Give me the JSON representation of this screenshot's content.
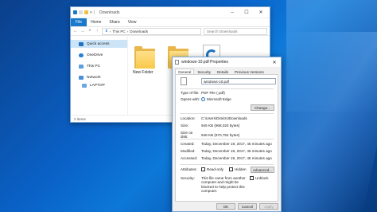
{
  "colors": {
    "desktop": "#0a63c9",
    "accent": "#1979ca",
    "folder": "#f7c948",
    "selection": "#cce4f7"
  },
  "explorer": {
    "title": "Downloads",
    "ribbon_tabs": [
      "File",
      "Home",
      "Share",
      "View"
    ],
    "path": [
      "This PC",
      "Downloads"
    ],
    "search_placeholder": "Search Downloads",
    "nav": {
      "quick_access": "Quick access",
      "onedrive": "OneDrive",
      "this_pc": "This PC",
      "network": "Network",
      "laptop": "LAPTOP"
    },
    "items": {
      "folder1": "New Folder",
      "folder2": "",
      "pdf": "pdf"
    },
    "status": "2 items"
  },
  "props": {
    "title": "windows-10.pdf Properties",
    "tabs": [
      "General",
      "Security",
      "Details",
      "Previous Versions"
    ],
    "filename": "windows-10.pdf",
    "type_label": "Type of file:",
    "type_value": "PDF File (.pdf)",
    "opens_label": "Opens with:",
    "opens_value": "Microsoft Edge",
    "change_label": "Change...",
    "location_label": "Location:",
    "location_value": "C:\\Users\\Dimitro\\Downloads",
    "size_label": "Size:",
    "size_value": "945 KB (968,020 bytes)",
    "size_disk_label": "Size on disk:",
    "size_disk_value": "948 KB (970,752 bytes)",
    "created_label": "Created:",
    "created_value": "Today, December 19, 2017, 45 minutes ago",
    "modified_label": "Modified:",
    "modified_value": "Today, December 19, 2017, 45 minutes ago",
    "accessed_label": "Accessed:",
    "accessed_value": "Today, December 19, 2017, 45 minutes ago",
    "attributes_label": "Attributes:",
    "readonly_label": "Read-only",
    "hidden_label": "Hidden",
    "advanced_label": "Advanced...",
    "security_label": "Security:",
    "security_text": "This file came from another computer and might be blocked to help protect this computer.",
    "unblock_label": "Unblock",
    "ok_label": "OK",
    "cancel_label": "Cancel",
    "apply_label": "Apply"
  }
}
